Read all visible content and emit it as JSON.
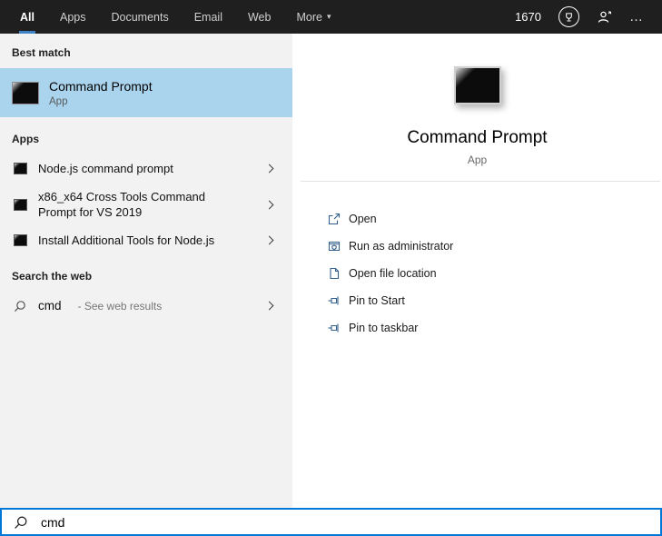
{
  "topbar": {
    "tabs": [
      {
        "label": "All"
      },
      {
        "label": "Apps"
      },
      {
        "label": "Documents"
      },
      {
        "label": "Email"
      },
      {
        "label": "Web"
      },
      {
        "label": "More"
      }
    ],
    "rewards_points": "1670",
    "more_options": "…"
  },
  "icons": {
    "caret_down": "▾"
  },
  "left_pane": {
    "best_match_header": "Best match",
    "best_match": {
      "title": "Command Prompt",
      "subtitle": "App"
    },
    "apps_header": "Apps",
    "apps": [
      {
        "label": "Node.js command prompt"
      },
      {
        "label": "x86_x64 Cross Tools Command Prompt for VS 2019"
      },
      {
        "label": "Install Additional Tools for Node.js"
      }
    ],
    "web_header": "Search the web",
    "web_result": {
      "query": "cmd",
      "suffix": "- See web results"
    }
  },
  "right_pane": {
    "title": "Command Prompt",
    "subtitle": "App",
    "actions": [
      {
        "label": "Open"
      },
      {
        "label": "Run as administrator"
      },
      {
        "label": "Open file location"
      },
      {
        "label": "Pin to Start"
      },
      {
        "label": "Pin to taskbar"
      }
    ]
  },
  "search": {
    "value": "cmd"
  },
  "colors": {
    "accent": "#0078d7",
    "best_match_highlight": "#aad4ee",
    "topbar_bg": "#1f1f1f"
  }
}
